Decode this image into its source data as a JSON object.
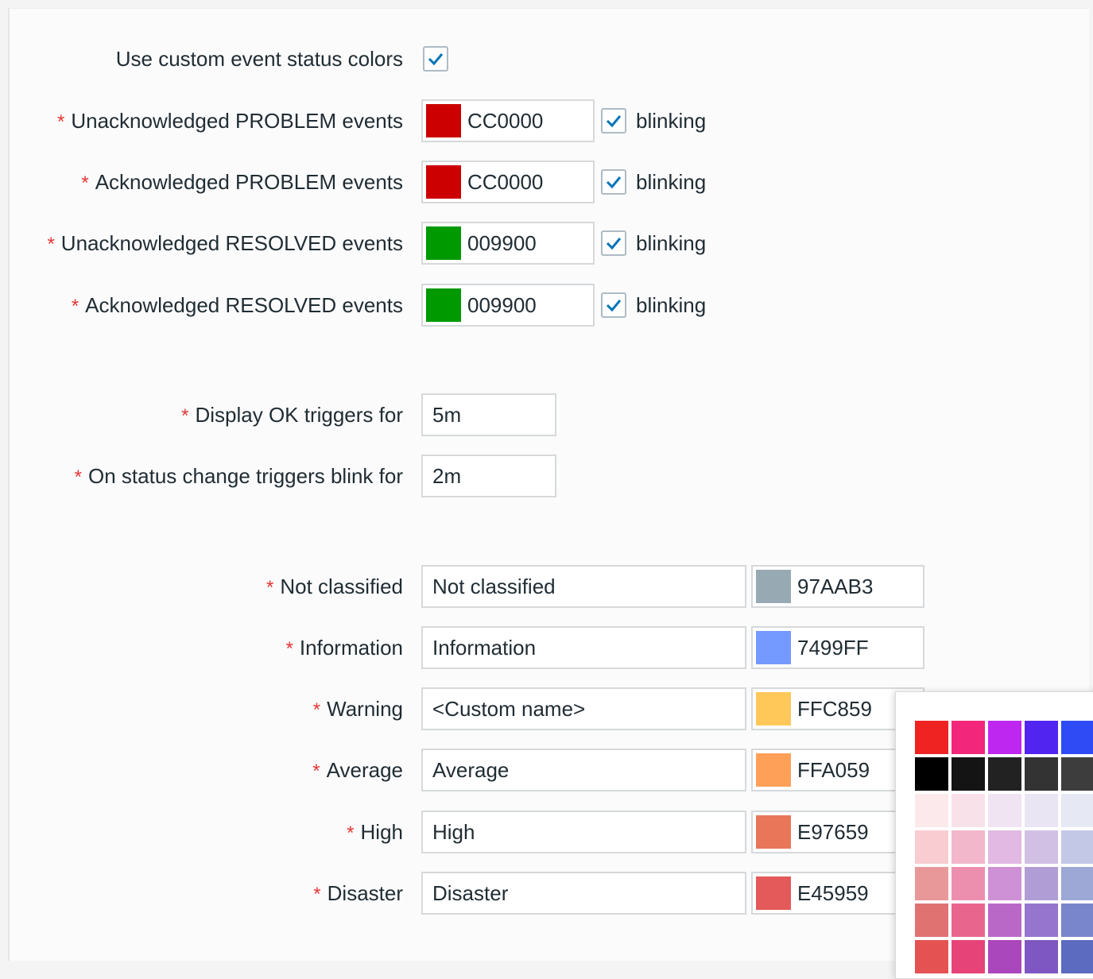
{
  "custom_colors": {
    "label": "Use custom event status colors",
    "checked": true
  },
  "event_colors": [
    {
      "label": "Unacknowledged PROBLEM events",
      "value": "CC0000",
      "color": "#CC0000",
      "blinking": true
    },
    {
      "label": "Acknowledged PROBLEM events",
      "value": "CC0000",
      "color": "#CC0000",
      "blinking": true
    },
    {
      "label": "Unacknowledged RESOLVED events",
      "value": "009900",
      "color": "#009900",
      "blinking": true
    },
    {
      "label": "Acknowledged RESOLVED events",
      "value": "009900",
      "color": "#009900",
      "blinking": true
    }
  ],
  "blinking_label": "blinking",
  "required_mark": "*",
  "display_ok": {
    "label": "Display OK triggers for",
    "value": "5m"
  },
  "blink_for": {
    "label": "On status change triggers blink for",
    "value": "2m"
  },
  "severities": [
    {
      "label": "Not classified",
      "name": "Not classified",
      "value": "97AAB3",
      "color": "#97AAB3"
    },
    {
      "label": "Information",
      "name": "Information",
      "value": "7499FF",
      "color": "#7499FF"
    },
    {
      "label": "Warning",
      "name": "<Custom name>",
      "value": "FFC859",
      "color": "#FFC859"
    },
    {
      "label": "Average",
      "name": "Average",
      "value": "FFA059",
      "color": "#FFA059"
    },
    {
      "label": "High",
      "name": "High",
      "value": "E97659",
      "color": "#E97659"
    },
    {
      "label": "Disaster",
      "name": "Disaster",
      "value": "E45959",
      "color": "#E45959"
    }
  ],
  "palette": [
    [
      "#F02323",
      "#F2267A",
      "#BE27F0",
      "#5124F0",
      "#2E4BF5"
    ],
    [
      "#000000",
      "#141414",
      "#222222",
      "#333333",
      "#3D3D3D"
    ],
    [
      "#FBE9EB",
      "#F9E1EA",
      "#F0E3F2",
      "#EAE5F3",
      "#E6E8F4"
    ],
    [
      "#F8CCD1",
      "#F3B7CC",
      "#E1B9E2",
      "#D1C0E3",
      "#C3C8E6"
    ],
    [
      "#E89898",
      "#EC8FAE",
      "#CE91D6",
      "#B09DD5",
      "#9EA8D6"
    ],
    [
      "#E07272",
      "#E8668E",
      "#BA68C8",
      "#9575CD",
      "#7986CB"
    ],
    [
      "#E55252",
      "#E64479",
      "#AB47BC",
      "#7E57C2",
      "#5C6BC0"
    ]
  ]
}
